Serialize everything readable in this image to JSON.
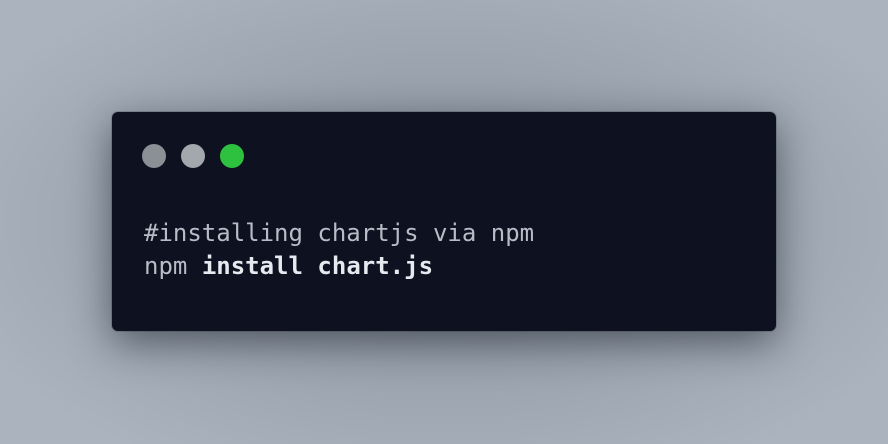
{
  "window": {
    "controls": [
      {
        "name": "close",
        "color": "#8b8f96"
      },
      {
        "name": "minimize",
        "color": "#a3a7ae"
      },
      {
        "name": "maximize",
        "color": "#2ec13f"
      }
    ]
  },
  "code": {
    "line1": "#installing chartjs via npm",
    "line2": {
      "command": "npm",
      "subcommand": "install",
      "package": "chart.js"
    }
  }
}
